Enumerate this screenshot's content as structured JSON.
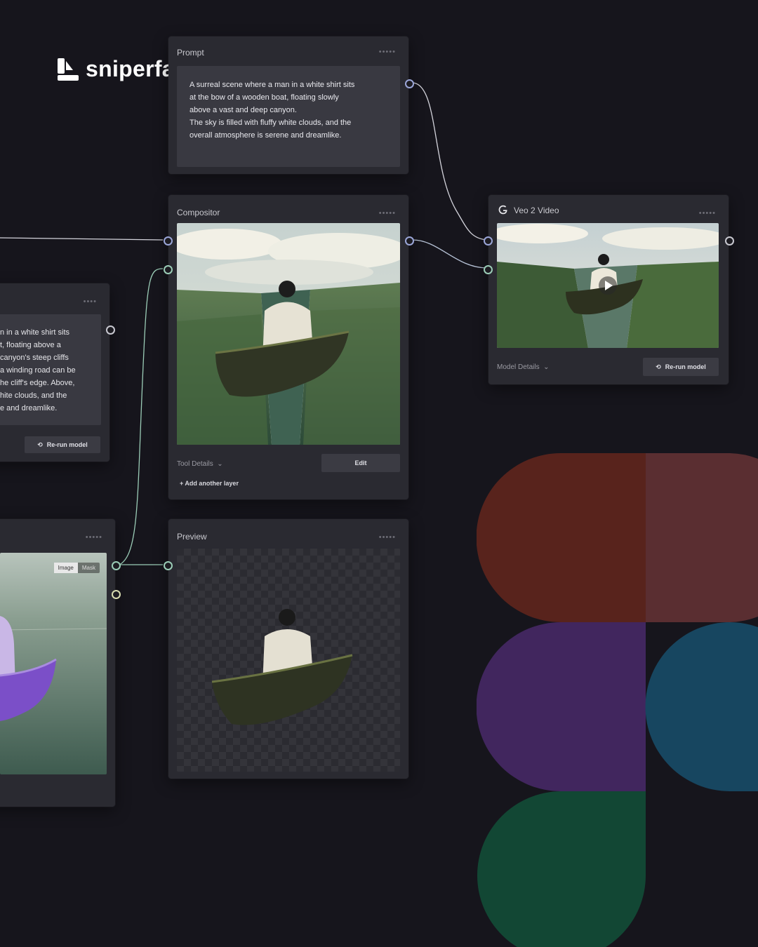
{
  "brand": {
    "name": "sniperfactory"
  },
  "prompt_node": {
    "title": "Prompt",
    "lines": [
      "A surreal scene where a man in a white shirt sits",
      "at the bow of a wooden boat, floating slowly",
      "above a vast and deep canyon.",
      "The sky is filled with fluffy white clouds, and the",
      "overall atmosphere is serene and dreamlike."
    ]
  },
  "compositor_node": {
    "title": "Compositor",
    "tool_details": "Tool Details",
    "edit_button": "Edit",
    "add_layer": "+ Add another layer"
  },
  "veo_node": {
    "title": "Veo 2 Video",
    "model_details": "Model Details",
    "rerun_button": "Re-run model"
  },
  "left_text_node": {
    "lines": [
      "n in a white shirt sits",
      "t, floating above a",
      "canyon's steep cliffs",
      "a winding road can be",
      "he cliff's edge. Above,",
      "hite clouds, and the",
      "e and dreamlike."
    ],
    "rerun_button": "Re-run model"
  },
  "left_image_node": {
    "tab_image": "Image",
    "tab_mask": "Mask"
  },
  "preview_node": {
    "title": "Preview"
  },
  "colors": {
    "background": "#16151c",
    "node": "#2a2a31",
    "figma_red": "#58231c",
    "figma_rose": "#5a2e31",
    "figma_purple": "#41265e",
    "figma_blue": "#174660",
    "figma_green": "#124734"
  }
}
